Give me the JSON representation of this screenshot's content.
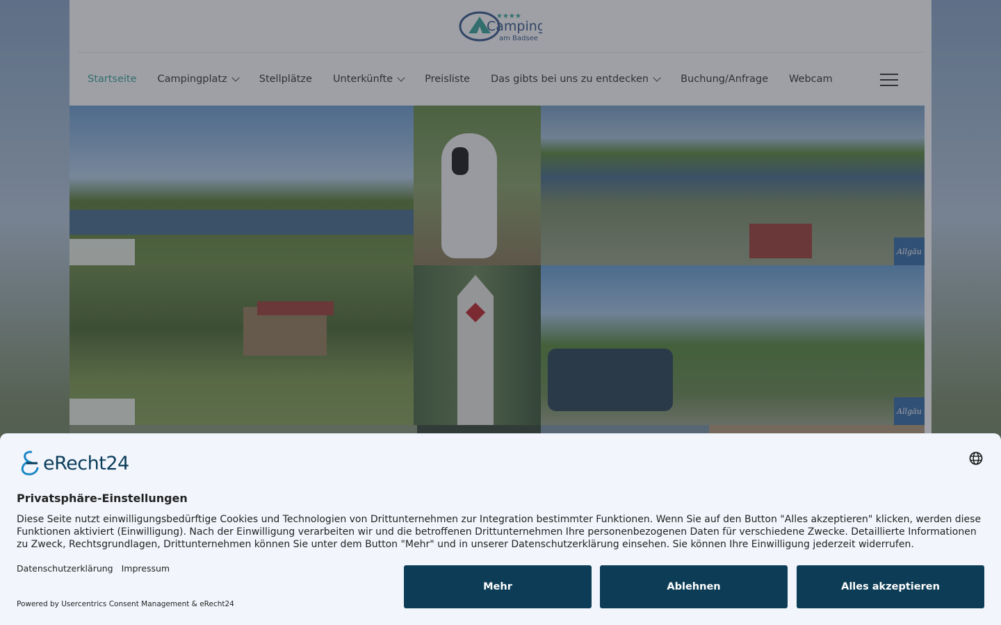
{
  "site": {
    "logo_word": "Camping",
    "logo_sub": "am Badsee",
    "logo_stars": "★★★★"
  },
  "nav": {
    "items": [
      {
        "label": "Startseite",
        "active": true,
        "dropdown": false
      },
      {
        "label": "Campingplatz",
        "active": false,
        "dropdown": true
      },
      {
        "label": "Stellplätze",
        "active": false,
        "dropdown": false
      },
      {
        "label": "Unterkünfte",
        "active": false,
        "dropdown": true
      },
      {
        "label": "Preisliste",
        "active": false,
        "dropdown": false
      },
      {
        "label": "Das gibts bei uns zu entdecken",
        "active": false,
        "dropdown": true
      },
      {
        "label": "Buchung/Anfrage",
        "active": false,
        "dropdown": false
      },
      {
        "label": "Webcam",
        "active": false,
        "dropdown": false
      }
    ],
    "menu_icon": "hamburger-icon"
  },
  "gallery": {
    "badge_allgaeu": "Allgäu"
  },
  "consent": {
    "brand": "eRecht24",
    "title": "Privatsphäre-Einstellungen",
    "text": "Diese Seite nutzt einwilligungsbedürftige Cookies und Technologien von Drittunternehmen zur Integration bestimmter Funktionen. Wenn Sie auf den Button \"Alles akzeptieren\" klicken, werden diese Funktionen aktiviert (Einwilligung). Nach der Einwilligung verarbeiten wir und die betroffenen Drittunternehmen Ihre personenbezogenen Daten für verschiedene Zwecke. Detaillierte Informationen zu Zweck, Rechtsgrundlagen, Drittunternehmen können Sie unter dem Button \"Mehr\" und in unserer Datenschutzerklärung einsehen. Sie können Ihre Einwilligung jederzeit widerrufen.",
    "link_privacy": "Datenschutzerklärung",
    "link_imprint": "Impressum",
    "powered": "Powered by Usercentrics Consent Management & eRecht24",
    "btn_more": "Mehr",
    "btn_decline": "Ablehnen",
    "btn_accept": "Alles akzeptieren",
    "globe_icon": "globe-icon"
  },
  "colors": {
    "accent": "#3ba59b",
    "button": "#0d3d56",
    "consent_bg": "#f2f6fc"
  }
}
